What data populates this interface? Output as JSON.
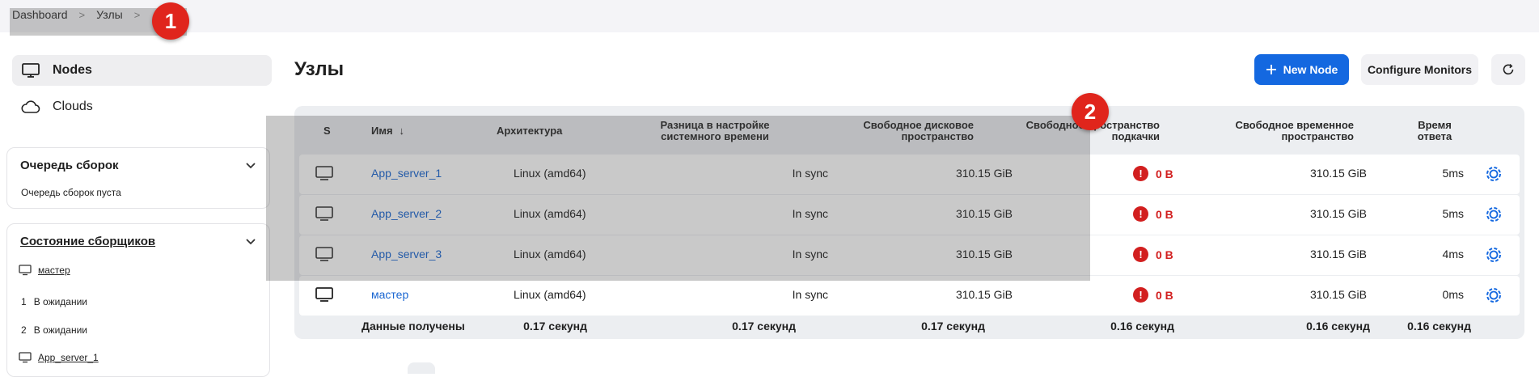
{
  "breadcrumb": {
    "items": [
      "Dashboard",
      "Узлы"
    ],
    "separator": ">"
  },
  "markers": [
    "1",
    "2"
  ],
  "sidebar": {
    "nav": [
      {
        "label": "Nodes",
        "icon": "computer-icon",
        "active": true
      },
      {
        "label": "Clouds",
        "icon": "cloud-icon",
        "active": false
      }
    ],
    "build_queue": {
      "title": "Очередь сборок",
      "empty_text": "Очередь сборок пуста"
    },
    "executors": {
      "title": "Состояние сборщиков",
      "nodes": [
        {
          "name": "мастер",
          "executors": [
            {
              "num": "1",
              "status": "В ожидании"
            },
            {
              "num": "2",
              "status": "В ожидании"
            }
          ]
        },
        {
          "name": "App_server_1"
        }
      ]
    }
  },
  "page": {
    "title": "Узлы"
  },
  "toolbar": {
    "new_node": "New Node",
    "configure_monitors": "Configure Monitors"
  },
  "table": {
    "headers": {
      "s": "S",
      "name": "Имя",
      "sort_arrow": "↓",
      "arch": "Архитектура",
      "clock_1": "Разница в настройке",
      "clock_2": "системного времени",
      "disk_1": "Свободное дисковое",
      "disk_2": "пространство",
      "swap_1": "Свободное пространство",
      "swap_2": "подкачки",
      "temp_1": "Свободное временное",
      "temp_2": "пространство",
      "resp_1": "Время",
      "resp_2": "ответа"
    },
    "rows": [
      {
        "name": "App_server_1",
        "arch": "Linux (amd64)",
        "clock": "In sync",
        "disk": "310.15 GiB",
        "swap": "0 B",
        "temp": "310.15 GiB",
        "resp": "5ms"
      },
      {
        "name": "App_server_2",
        "arch": "Linux (amd64)",
        "clock": "In sync",
        "disk": "310.15 GiB",
        "swap": "0 B",
        "temp": "310.15 GiB",
        "resp": "5ms"
      },
      {
        "name": "App_server_3",
        "arch": "Linux (amd64)",
        "clock": "In sync",
        "disk": "310.15 GiB",
        "swap": "0 B",
        "temp": "310.15 GiB",
        "resp": "4ms"
      },
      {
        "name": "мастер",
        "arch": "Linux (amd64)",
        "clock": "In sync",
        "disk": "310.15 GiB",
        "swap": "0 B",
        "temp": "310.15 GiB",
        "resp": "0ms"
      }
    ],
    "footer": {
      "label": "Данные получены",
      "arch": "0.17 секунд",
      "clock": "0.17 секунд",
      "disk": "0.17 секунд",
      "swap": "0.16 секунд",
      "temp": "0.16 секунд",
      "resp": "0.16 секунд"
    }
  },
  "colors": {
    "accent": "#1468e0",
    "link": "#1a66d1",
    "error": "#d21f1f",
    "marker": "#e0251c"
  }
}
